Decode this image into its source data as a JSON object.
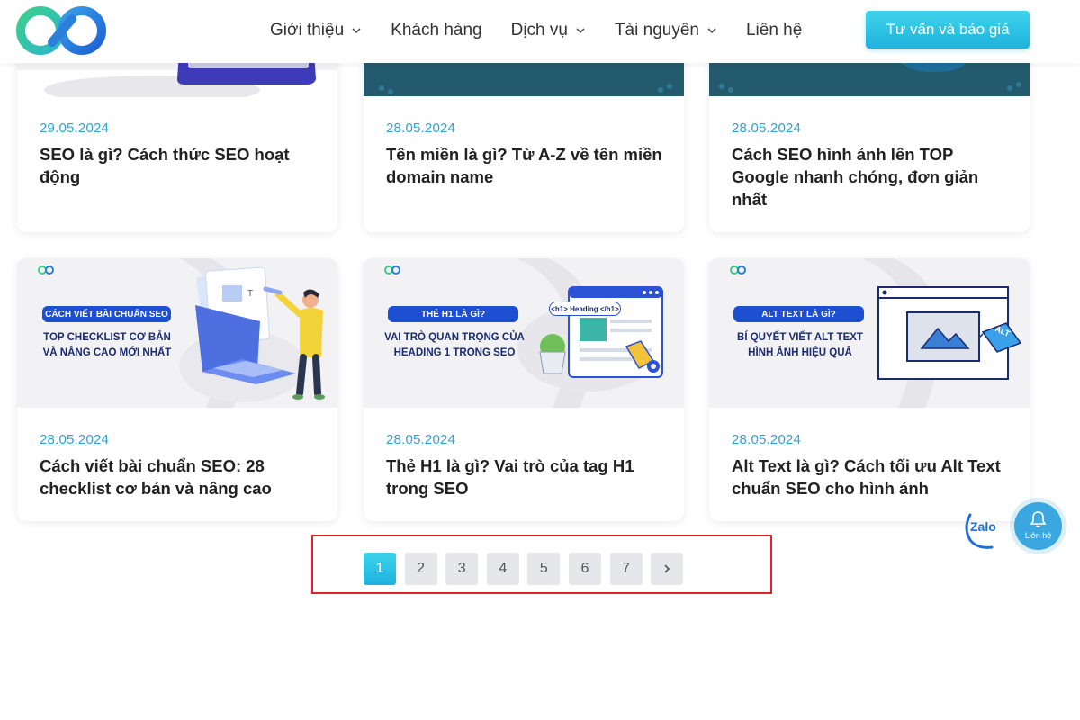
{
  "header": {
    "nav": [
      {
        "label": "Giới thiệu",
        "has_dropdown": true
      },
      {
        "label": "Khách hàng",
        "has_dropdown": false
      },
      {
        "label": "Dịch vụ",
        "has_dropdown": true
      },
      {
        "label": "Tài nguyên",
        "has_dropdown": true
      },
      {
        "label": "Liên hệ",
        "has_dropdown": false
      }
    ],
    "cta_label": "Tư vấn và báo giá"
  },
  "posts": [
    {
      "date": "29.05.2024",
      "title": "SEO là gì? Cách thức SEO hoạt động"
    },
    {
      "date": "28.05.2024",
      "title": "Tên miền là gì? Từ A-Z về tên miền domain name"
    },
    {
      "date": "28.05.2024",
      "title": "Cách SEO hình ảnh lên TOP Google nhanh chóng, đơn giản nhất"
    },
    {
      "date": "28.05.2024",
      "title": "Cách viết bài chuẩn SEO: 28 checklist cơ bản và nâng cao",
      "thumb": {
        "pill": "CÁCH VIẾT BÀI CHUẨN SEO",
        "line1": "TOP CHECKLIST CƠ BẢN",
        "line2": "VÀ NÂNG CAO MỚI NHẤT"
      }
    },
    {
      "date": "28.05.2024",
      "title": "Thẻ H1 là gì? Vai trò của tag H1 trong SEO",
      "thumb": {
        "pill": "THẺ H1 LÀ GÌ?",
        "line1": "VAI TRÒ QUAN TRỌNG CỦA",
        "line2": "HEADING 1 TRONG SEO",
        "tag": "<h1> Heading </h1>"
      }
    },
    {
      "date": "28.05.2024",
      "title": "Alt Text là gì? Cách tối ưu Alt Text chuẩn SEO cho hình ảnh",
      "thumb": {
        "pill": "ALT TEXT LÀ GÌ?",
        "line1": "BÍ QUYẾT VIẾT ALT TEXT",
        "line2": "HÌNH ẢNH HIỆU QUẢ",
        "tag": "ALT"
      }
    }
  ],
  "pagination": {
    "pages": [
      "1",
      "2",
      "3",
      "4",
      "5",
      "6",
      "7"
    ],
    "current": "1",
    "next_icon": "chevron-right-icon"
  },
  "widgets": {
    "zalo_label": "Zalo",
    "contact_label": "Liên hệ"
  },
  "colors": {
    "accent": "#1fb2de",
    "date": "#2ba5cf",
    "highlight_box": "#e2222b",
    "pill_blue": "#1e4fd3"
  }
}
